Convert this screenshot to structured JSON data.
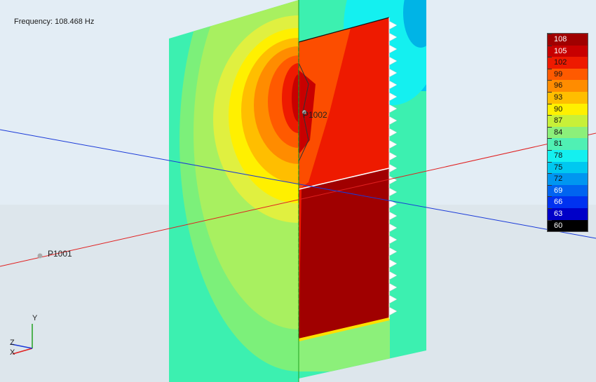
{
  "viewer": {
    "frequency_text": "Frequency: 108.468 Hz"
  },
  "points": {
    "p1001": "P1001",
    "p1002": "P1002"
  },
  "axes": {
    "y": "Y",
    "z": "Z",
    "x": "X"
  },
  "legend": {
    "levels": [
      {
        "value": "108",
        "color": "#a00000"
      },
      {
        "value": "105",
        "color": "#c80000"
      },
      {
        "value": "102",
        "color": "#ee1a00"
      },
      {
        "value": "99",
        "color": "#ff5a00"
      },
      {
        "value": "96",
        "color": "#ff8c00"
      },
      {
        "value": "93",
        "color": "#ffbe00"
      },
      {
        "value": "90",
        "color": "#fff000"
      },
      {
        "value": "87",
        "color": "#c8f038"
      },
      {
        "value": "84",
        "color": "#8cf07a"
      },
      {
        "value": "81",
        "color": "#50f0b4"
      },
      {
        "value": "78",
        "color": "#14f0f0"
      },
      {
        "value": "75",
        "color": "#00c8f0"
      },
      {
        "value": "72",
        "color": "#0096f0"
      },
      {
        "value": "69",
        "color": "#0064f0"
      },
      {
        "value": "66",
        "color": "#0032f0"
      },
      {
        "value": "63",
        "color": "#0000c8"
      },
      {
        "value": "60",
        "color": "#000000"
      }
    ]
  },
  "colors": {
    "background": "#e3edf5",
    "axis_red": "#e02020",
    "axis_blue": "#1a3ad8",
    "axis_green": "#20a020",
    "field_low": "#3cf0b0",
    "field_mid": "#a8f060",
    "field_high": "#ffe000"
  }
}
